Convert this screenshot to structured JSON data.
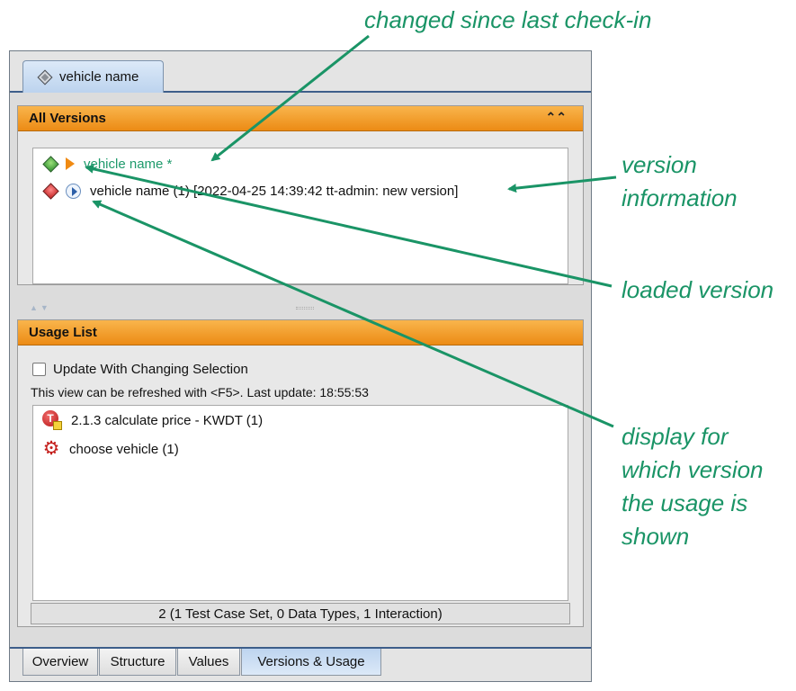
{
  "window": {
    "top_tab_label": "vehicle name",
    "all_versions": {
      "header": "All Versions",
      "rows": [
        {
          "label": "vehicle name *"
        },
        {
          "label": "vehicle name (1) [2022-04-25 14:39:42 tt-admin: new version]"
        }
      ]
    },
    "usage_list": {
      "header": "Usage List",
      "checkbox_label": "Update With Changing Selection",
      "checkbox_checked": false,
      "refresh_text": "This view can be refreshed with <F5>. Last update: 18:55:53",
      "rows": [
        {
          "label": "2.1.3 calculate price - KWDT (1)",
          "icon": "test-case-set-icon",
          "icon_letter": "T"
        },
        {
          "label": "choose vehicle (1)",
          "icon": "gear-icon"
        }
      ],
      "summary": "2 (1 Test Case Set, 0 Data Types, 1 Interaction)"
    },
    "bottom_tabs": [
      {
        "label": "Overview"
      },
      {
        "label": "Structure"
      },
      {
        "label": "Values"
      },
      {
        "label": "Versions & Usage",
        "active": true
      }
    ]
  },
  "annotations": {
    "changed": "changed since last check-in",
    "version_info_line1": "version",
    "version_info_line2": "information",
    "loaded": "loaded version",
    "display_line1": "display for",
    "display_line2": "which version",
    "display_line3": "the usage is",
    "display_line4": "shown"
  },
  "colors": {
    "annotation": "#1a9466",
    "header_orange": "#f4a128",
    "changed_text": "#1f9a6c"
  }
}
